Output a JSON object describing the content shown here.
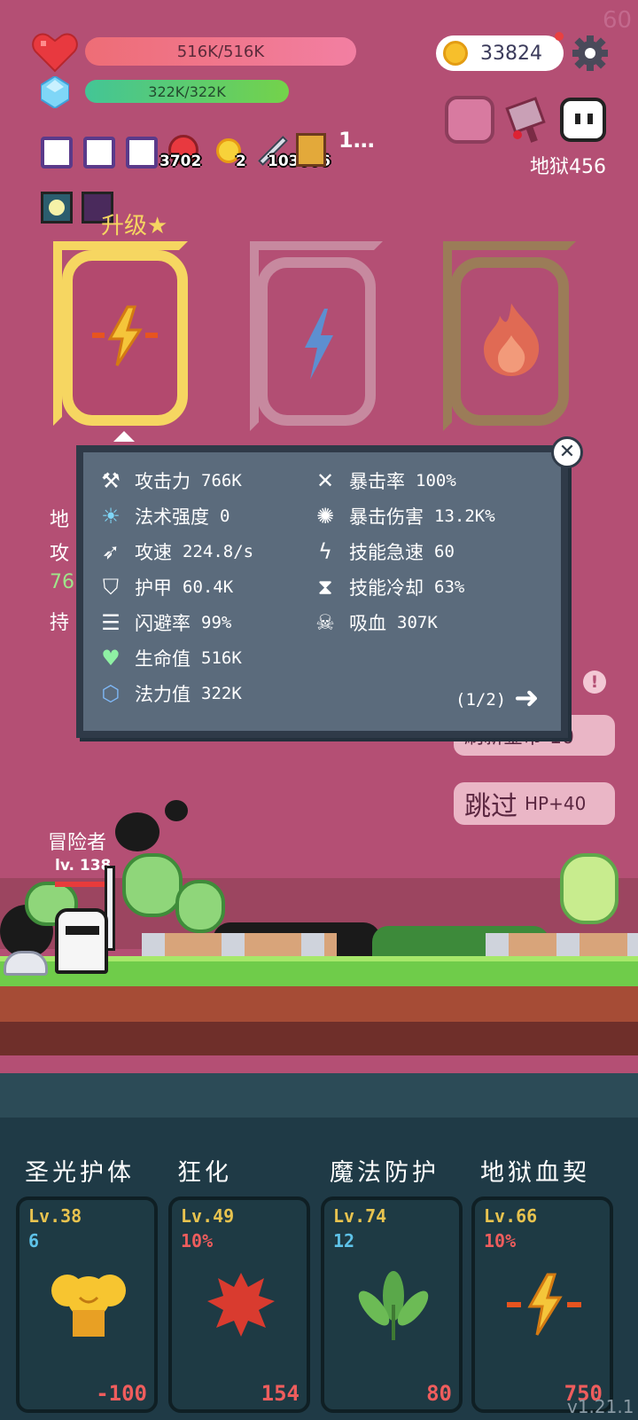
{
  "top_right_badge": "60",
  "hp": {
    "text": "516K/516K",
    "fill": 1.0
  },
  "mp": {
    "text": "322K/322K",
    "fill": 1.0
  },
  "coins": "33824",
  "inventory": [
    {
      "icon": "scroll-icon",
      "count": ""
    },
    {
      "icon": "scroll-icon",
      "count": ""
    },
    {
      "icon": "scroll-icon",
      "count": ""
    },
    {
      "icon": "apple-icon",
      "count": "3702"
    },
    {
      "icon": "sun-icon",
      "count": "2"
    },
    {
      "icon": "dagger-icon",
      "count": "103666"
    },
    {
      "icon": "book-icon",
      "count": ""
    }
  ],
  "inventory_more": "1…",
  "stage_label": "地狱456",
  "upgrade_label": "升级★",
  "left_partial": {
    "line1": "地",
    "line2": "攻",
    "line3": "76",
    "line4": "持"
  },
  "stats_panel": {
    "left": [
      {
        "icon": "axe-icon",
        "name": "攻击力",
        "value": "766K"
      },
      {
        "icon": "sun-icon",
        "name": "法术强度",
        "value": "0"
      },
      {
        "icon": "bow-icon",
        "name": "攻速",
        "value": "224.8/s"
      },
      {
        "icon": "shield-icon",
        "name": "护甲",
        "value": "60.4K"
      },
      {
        "icon": "dash-icon",
        "name": "闪避率",
        "value": "99%"
      },
      {
        "icon": "heart-icon",
        "name": "生命值",
        "value": "516K"
      },
      {
        "icon": "crystal-icon",
        "name": "法力值",
        "value": "322K"
      }
    ],
    "right": [
      {
        "icon": "crosshair-icon",
        "name": "暴击率",
        "value": "100%"
      },
      {
        "icon": "burst-icon",
        "name": "暴击伤害",
        "value": "13.2K%"
      },
      {
        "icon": "lightning-icon",
        "name": "技能急速",
        "value": "60"
      },
      {
        "icon": "hourglass-icon",
        "name": "技能冷却",
        "value": "63%"
      },
      {
        "icon": "skull-icon",
        "name": "吸血",
        "value": "307K"
      }
    ],
    "page": "(1/2)"
  },
  "side_buttons": {
    "refresh_partial": "刷新金币-10",
    "skip": "跳过",
    "skip_bonus": "HP+40"
  },
  "hero": {
    "name": "冒险者",
    "level": "lv. 138"
  },
  "skills": [
    {
      "title": "圣光护体",
      "level": "Lv.38",
      "sub": "6",
      "sub_color": "#5ec2e8",
      "cost": "-100",
      "icon": "golden-bell-icon"
    },
    {
      "title": "狂化",
      "level": "Lv.49",
      "sub": "10%",
      "sub_color": "#ef5d5d",
      "cost": "154",
      "icon": "red-splat-icon"
    },
    {
      "title": "魔法防护",
      "level": "Lv.74",
      "sub": "12",
      "sub_color": "#5ec2e8",
      "cost": "80",
      "icon": "green-leaf-icon"
    },
    {
      "title": "地狱血契",
      "level": "Lv.66",
      "sub": "10%",
      "sub_color": "#ef5d5d",
      "cost": "750",
      "icon": "spark-icon"
    }
  ],
  "version": "v1.21.1"
}
